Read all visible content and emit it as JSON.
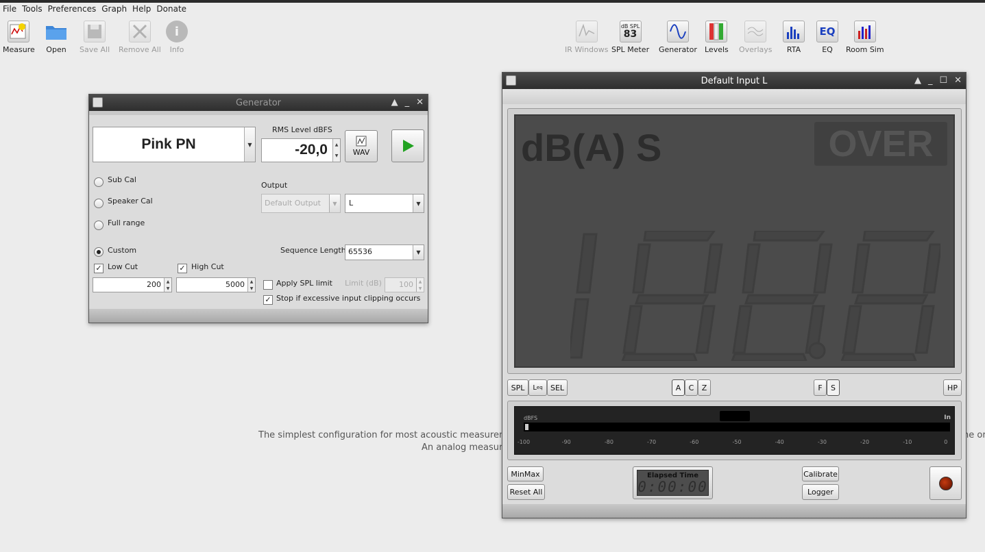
{
  "menu": {
    "items": [
      "File",
      "Tools",
      "Preferences",
      "Graph",
      "Help",
      "Donate"
    ]
  },
  "toolbar_left": [
    {
      "label": "Measure",
      "icon": "measure-icon"
    },
    {
      "label": "Open",
      "icon": "folder-icon"
    },
    {
      "label": "Save All",
      "icon": "save-icon"
    },
    {
      "label": "Remove All",
      "icon": "remove-icon"
    },
    {
      "label": "Info",
      "icon": "info-icon"
    }
  ],
  "toolbar_right": [
    {
      "label": "IR Windows",
      "icon": "ir-windows-icon"
    },
    {
      "label": "SPL Meter",
      "icon": "spl-meter-icon",
      "top": "dB SPL",
      "value": "83"
    },
    {
      "label": "Generator",
      "icon": "generator-icon"
    },
    {
      "label": "Levels",
      "icon": "levels-icon"
    },
    {
      "label": "Overlays",
      "icon": "overlays-icon"
    },
    {
      "label": "RTA",
      "icon": "rta-icon"
    },
    {
      "label": "EQ",
      "icon": "eq-icon",
      "text": "EQ"
    },
    {
      "label": "Room Sim",
      "icon": "room-sim-icon"
    }
  ],
  "background": {
    "line1": "The simplest configuration for most acoustic measureme",
    "line1_right": "ne or",
    "line2": "An analog measur"
  },
  "generator": {
    "title": "Generator",
    "signal": "Pink PN",
    "rms_label": "RMS Level dBFS",
    "rms_value": "-20,0",
    "wav_label": "WAV",
    "options": {
      "sub_cal": "Sub Cal",
      "speaker_cal": "Speaker Cal",
      "full_range": "Full range",
      "custom": "Custom"
    },
    "output_label": "Output",
    "output_device": "Default Output",
    "output_channel": "L",
    "sequence_label": "Sequence Length:",
    "sequence_value": "65536",
    "low_cut_label": "Low Cut",
    "low_cut_value": "200",
    "high_cut_label": "High Cut",
    "high_cut_value": "5000",
    "apply_spl_label": "Apply SPL limit",
    "limit_label": "Limit (dB)",
    "limit_value": "100",
    "stop_label": "Stop if excessive input clipping occurs"
  },
  "spl": {
    "title": "Default Input L",
    "mode": "dB(A) S",
    "over": "OVER",
    "buttons": {
      "spl": "SPL",
      "leq_main": "L",
      "leq_sub": "eq",
      "sel": "SEL",
      "a": "A",
      "c": "C",
      "z": "Z",
      "f": "F",
      "s": "S",
      "hp": "HP"
    },
    "meter": {
      "dbfs": "dBFS",
      "in": "In",
      "ticks": [
        "-100",
        "-90",
        "-80",
        "-70",
        "-60",
        "-50",
        "-40",
        "-30",
        "-20",
        "-10",
        "0"
      ]
    },
    "minmax": "MinMax",
    "reset": "Reset All",
    "elapsed_label": "Elapsed Time",
    "elapsed_value": "0:00:00",
    "calibrate": "Calibrate",
    "logger": "Logger"
  }
}
